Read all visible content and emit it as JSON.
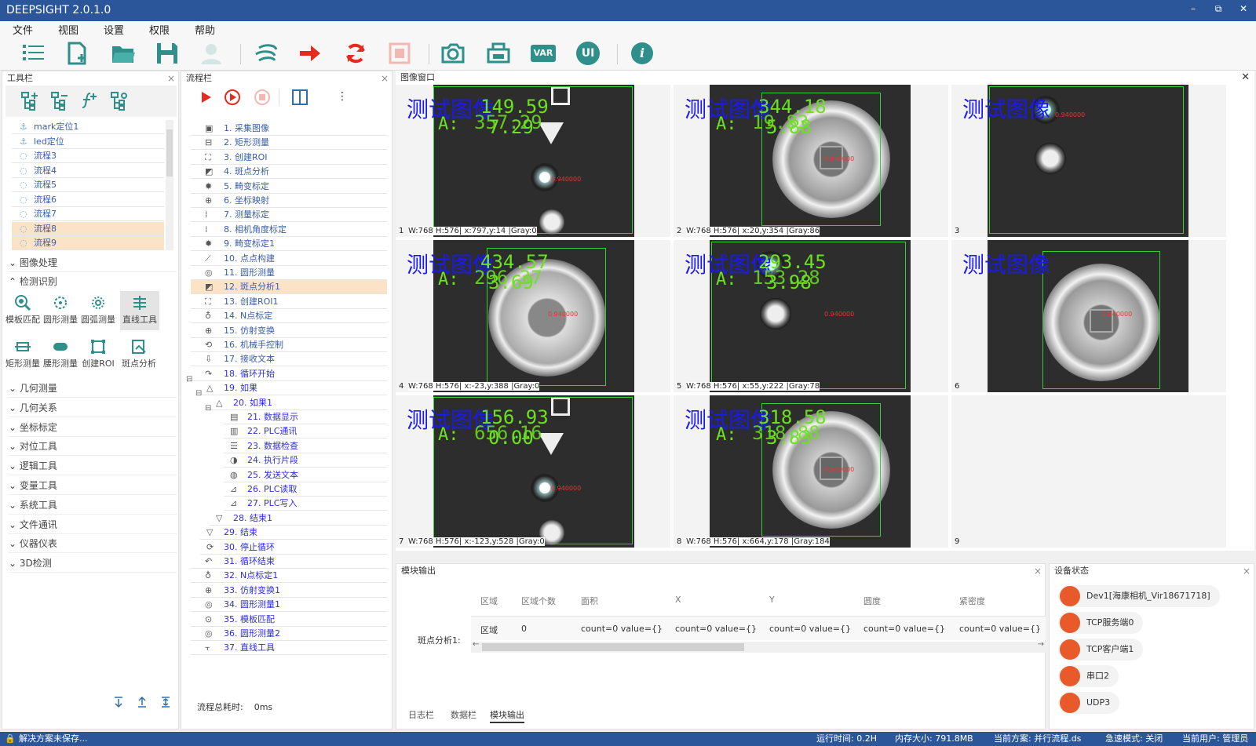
{
  "app": {
    "title": "DEEPSIGHT 2.0.1.0"
  },
  "window_controls": {
    "minimize": "–",
    "restore": "⧉",
    "close": "✕"
  },
  "menu": [
    "文件",
    "视图",
    "设置",
    "权限",
    "帮助"
  ],
  "toolbar_icons": [
    "list-icon",
    "new-file-icon",
    "open-folder-icon",
    "save-icon",
    "user-icon",
    "run-continuous-icon",
    "run-arrow-icon",
    "refresh-icon",
    "stop-icon",
    "camera-icon",
    "printer-icon",
    "var-icon",
    "ui-icon",
    "info-icon"
  ],
  "toolbar_text": {
    "var": "VAR",
    "ui": "UI",
    "info": "i"
  },
  "toolbox": {
    "title": "工具栏",
    "close": "×",
    "flows": [
      "mark定位1",
      "led定位",
      "流程3",
      "流程4",
      "流程5",
      "流程6",
      "流程7",
      "流程8",
      "流程9"
    ],
    "sections_top": [
      "图像处理",
      "检测识别"
    ],
    "tools_row1": [
      "模板匹配",
      "圆形测量",
      "圆弧测量",
      "直线工具"
    ],
    "tools_row2": [
      "矩形测量",
      "腰形测量",
      "创建ROI",
      "斑点分析"
    ],
    "sections": [
      "几何测量",
      "几何关系",
      "坐标标定",
      "对位工具",
      "逻辑工具",
      "变量工具",
      "系统工具",
      "文件通讯",
      "仪器仪表",
      "3D检测"
    ]
  },
  "flow": {
    "title": "流程栏",
    "close": "×",
    "items": [
      "1. 采集图像",
      "2. 矩形测量",
      "3. 创建ROI",
      "4. 斑点分析",
      "5. 畸变标定",
      "6. 坐标映射",
      "7. 测量标定",
      "8. 相机角度标定",
      "9. 畸变标定1",
      "10. 点点构建",
      "11. 圆形测量",
      "12. 斑点分析1",
      "13. 创建ROI1",
      "14. N点标定",
      "15. 仿射变换",
      "16. 机械手控制",
      "17. 接收文本",
      "18. 循环开始",
      "19. 如果",
      "20. 如果1",
      "21. 数据显示",
      "22. PLC通讯",
      "23. 数据检查",
      "24. 执行片段",
      "25. 发送文本",
      "26. PLC读取",
      "27. PLC写入",
      "28. 结束1",
      "29. 结束",
      "30. 停止循环",
      "31. 循环结束",
      "32. N点标定1",
      "33. 仿射变换1",
      "34. 圆形测量1",
      "35. 模板匹配",
      "36. 圆形测量2",
      "37. 直线工具"
    ],
    "total_label": "流程总耗时:",
    "total_value": "0ms"
  },
  "image_window": {
    "title": "图像窗口",
    "close": "✕",
    "caption": "测试图像",
    "caption_prefix": "A:",
    "cells": [
      {
        "num": "1",
        "info": "W:768 H:576| x:797,y:14 |Gray:0",
        "v1": "149.59",
        "v2": "357.29",
        "v3": "7.29"
      },
      {
        "num": "2",
        "info": "W:768 H:576| x:20,y:354 |Gray:86",
        "v1": "344.18",
        "v2": "19.83",
        "v3": "5.88"
      },
      {
        "num": "3",
        "info": "",
        "v1": "",
        "v2": "",
        "v3": ""
      },
      {
        "num": "4",
        "info": "W:768 H:576| x:-23,y:388 |Gray:0",
        "v1": "434.57",
        "v2": "296.37",
        "v3": "3.69"
      },
      {
        "num": "5",
        "info": "W:768 H:576| x:55,y:222 |Gray:78",
        "v1": "293.45",
        "v2": "153.28",
        "v3": "3.98"
      },
      {
        "num": "6",
        "info": "",
        "v1": "",
        "v2": "",
        "v3": ""
      },
      {
        "num": "7",
        "info": "W:768 H:576| x:-123,y:528 |Gray:0",
        "v1": "156.93",
        "v2": "656.16",
        "v3": "0.00"
      },
      {
        "num": "8",
        "info": "W:768 H:576| x:664,y:178 |Gray:184",
        "v1": "318.58",
        "v2": "318.88",
        "v3": "3.83"
      },
      {
        "num": "9",
        "info": "",
        "v1": "",
        "v2": "",
        "v3": ""
      }
    ],
    "marker_text": "0.940000"
  },
  "module_output": {
    "title": "模块输出",
    "close": "×",
    "row_label": "斑点分析1:",
    "columns": [
      "区域",
      "区域个数",
      "面积",
      "X",
      "Y",
      "圆度",
      "紧密度"
    ],
    "row": [
      "区域",
      "0",
      "count=0  value={}",
      "count=0  value={}",
      "count=0  value={}",
      "count=0  value={}",
      "count=0  value={}"
    ],
    "tabs": [
      "日志栏",
      "数据栏",
      "模块输出"
    ]
  },
  "device_status": {
    "title": "设备状态",
    "close": "×",
    "devices": [
      "Dev1[海康相机_Vir18671718]",
      "TCP服务端0",
      "TCP客户端1",
      "串口2",
      "UDP3"
    ]
  },
  "status": {
    "left": "解决方案未保存...",
    "runtime": "运行时间: 0.2H",
    "memory": "内存大小: 791.8MB",
    "scheme": "当前方案: 并行流程.ds",
    "estop": "急速模式: 关闭",
    "user": "当前用户: 管理员"
  },
  "colors": {
    "titlebar": "#2b579a",
    "highlight": "#fbe3c8",
    "accent_red": "#e32b1f",
    "teal_icon": "#2f8f8a",
    "device": "#e85a2a"
  }
}
